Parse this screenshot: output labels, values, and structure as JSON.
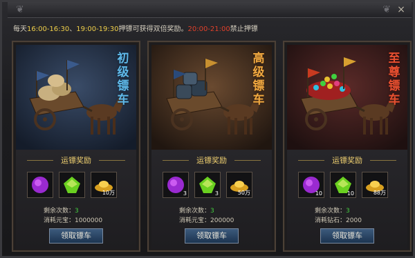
{
  "notice": {
    "prefix": "每天",
    "time1": "16:00-16:30",
    "sep": "、",
    "time2": "19:00-19:30",
    "middle": "押镖可获得双倍奖励。",
    "time3": "20:00-21:00",
    "suffix": "禁止押镖"
  },
  "close_label": "×",
  "reward_header": "运镖奖励",
  "claim_label": "领取镖车",
  "cards": [
    {
      "title": "初级镖车",
      "title_color": "#5fb8e8",
      "bg_color": "#243248",
      "items": [
        {
          "icon": "purple-orb-icon",
          "count": ""
        },
        {
          "icon": "green-gem-icon",
          "count": ""
        },
        {
          "icon": "gold-ingot-icon",
          "count": "10万"
        }
      ],
      "remain_label": "剩余次数：",
      "remain_value": "3",
      "cost_label": "消耗元宝：",
      "cost_value": "1000000"
    },
    {
      "title": "高级镖车",
      "title_color": "#f0a840",
      "bg_color": "#3a2a20",
      "items": [
        {
          "icon": "purple-orb-icon",
          "count": "3"
        },
        {
          "icon": "green-gem-icon",
          "count": "3"
        },
        {
          "icon": "gold-ingot-icon",
          "count": "50万"
        }
      ],
      "remain_label": "剩余次数：",
      "remain_value": "3",
      "cost_label": "消耗元宝：",
      "cost_value": "200000"
    },
    {
      "title": "至尊镖车",
      "title_color": "#e85030",
      "bg_color": "#3a1e1c",
      "items": [
        {
          "icon": "purple-orb-icon",
          "count": "10"
        },
        {
          "icon": "green-gem-icon",
          "count": "10"
        },
        {
          "icon": "gold-ingot-icon",
          "count": "88万"
        }
      ],
      "remain_label": "剩余次数：",
      "remain_value": "3",
      "cost_label": "消耗钻石：",
      "cost_value": "2000"
    }
  ]
}
